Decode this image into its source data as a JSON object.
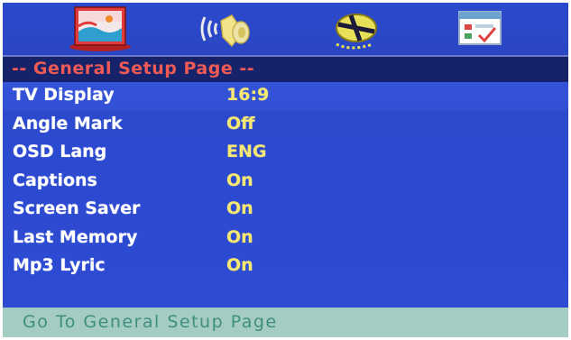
{
  "colors": {
    "background": "#2c4ad0",
    "title_strip": "#16226a",
    "title_text": "#f05a55",
    "label_text": "#ffffff",
    "value_text": "#f6e873",
    "status_bar": "#a4ccc2",
    "status_text": "#3f8f7e"
  },
  "top_icons": [
    {
      "name": "general-setup-icon"
    },
    {
      "name": "audio-setup-icon"
    },
    {
      "name": "video-setup-icon"
    },
    {
      "name": "preferences-icon"
    }
  ],
  "title": "-- General Setup Page --",
  "items": [
    {
      "label": "TV Display",
      "value": "16:9"
    },
    {
      "label": "Angle Mark",
      "value": "Off"
    },
    {
      "label": "OSD Lang",
      "value": "ENG"
    },
    {
      "label": "Captions",
      "value": "On"
    },
    {
      "label": "Screen Saver",
      "value": "On"
    },
    {
      "label": "Last Memory",
      "value": "On"
    },
    {
      "label": "Mp3 Lyric",
      "value": "On"
    }
  ],
  "status": "Go To General Setup Page"
}
